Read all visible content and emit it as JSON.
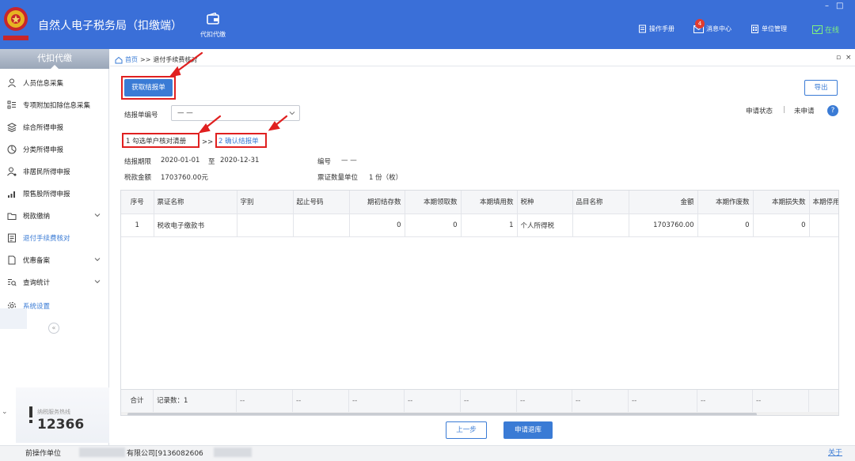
{
  "app": {
    "title": "自然人电子税务局（扣缴端）",
    "module_label": "代扣代缴",
    "toolbar": [
      {
        "label": "操作手册",
        "icon": "manual-icon"
      },
      {
        "label": "消息中心",
        "icon": "mail-icon",
        "badge": "4"
      },
      {
        "label": "单位管理",
        "icon": "building-icon"
      },
      {
        "label": "在线",
        "icon": "online-status-icon"
      }
    ],
    "window_controls": [
      "–",
      "□"
    ]
  },
  "sidebar": {
    "header": "代扣代缴",
    "items": [
      {
        "label": "人员信息采集",
        "icon": "person-icon",
        "expandable": false
      },
      {
        "label": "专项附加扣除信息采集",
        "icon": "list-icon",
        "expandable": false
      },
      {
        "label": "综合所得申报",
        "icon": "layers-icon",
        "expandable": false
      },
      {
        "label": "分类所得申报",
        "icon": "pie-chart-icon",
        "expandable": false
      },
      {
        "label": "非居民所得申报",
        "icon": "person-star-icon",
        "expandable": false
      },
      {
        "label": "限售股所得申报",
        "icon": "bar-chart-icon",
        "expandable": false
      },
      {
        "label": "税款缴纳",
        "icon": "folder-icon",
        "expandable": true
      },
      {
        "label": "退付手续费核对",
        "icon": "receipt-icon",
        "expandable": false,
        "active": true
      },
      {
        "label": "优惠备案",
        "icon": "document-icon",
        "expandable": true
      },
      {
        "label": "查询统计",
        "icon": "search-list-icon",
        "expandable": true
      },
      {
        "label": "系统设置",
        "icon": "gear-icon",
        "expandable": false
      }
    ],
    "collapse_symbol": "«",
    "hotline": {
      "label": "纳税服务热线",
      "number": "12366"
    }
  },
  "breadcrumb": {
    "home": "首页",
    "separator": ">>",
    "current": "退付手续费核对"
  },
  "page": {
    "get_button": "获取结报单",
    "export_button": "导出",
    "report_no_label": "结报单编号",
    "report_no_value": "— —",
    "status_label": "申请状态",
    "status_sep": "|",
    "status_value": "未申请",
    "help": "?",
    "steps": [
      {
        "label": "1 勾选单户核对清册",
        "active": false
      },
      {
        "label": "2 确认结报单",
        "active": true
      }
    ],
    "step_sep": ">>",
    "period_label": "结报期限",
    "period_start": "2020-01-01",
    "period_to": "至",
    "period_end": "2020-12-31",
    "code_label": "编号",
    "code_value": "— —",
    "tax_amount_label": "税款金额",
    "tax_amount_value": "1703760.00元",
    "ticket_unit_label": "票证数量单位",
    "ticket_unit_value": "1 份（枚）"
  },
  "table": {
    "columns": [
      "序号",
      "票证名称",
      "字别",
      "起止号码",
      "期初结存数",
      "本期领取数",
      "本期填用数",
      "税种",
      "品目名称",
      "金额",
      "本期作废数",
      "本期损失数",
      "本期停用"
    ],
    "rows": [
      [
        "1",
        "税收电子缴款书",
        "",
        "",
        "0",
        "0",
        "1",
        "个人所得税",
        "",
        "1703760.00",
        "0",
        "0",
        ""
      ]
    ],
    "footer": {
      "total_label": "合计",
      "record_count": "记录数：1",
      "placeholders": [
        "--",
        "--",
        "--",
        "--",
        "--",
        "--",
        "--",
        "--",
        "--",
        "--"
      ]
    }
  },
  "actions": {
    "prev": "上一步",
    "apply": "申请退库"
  },
  "bottom": {
    "operator_label": "前操作单位",
    "company_fragment": "有限公司[9136082606",
    "link": "关于"
  },
  "colors": {
    "brand_blue": "#3a6fd8",
    "accent": "#3a7bd5",
    "highlight_red": "#e02020"
  }
}
